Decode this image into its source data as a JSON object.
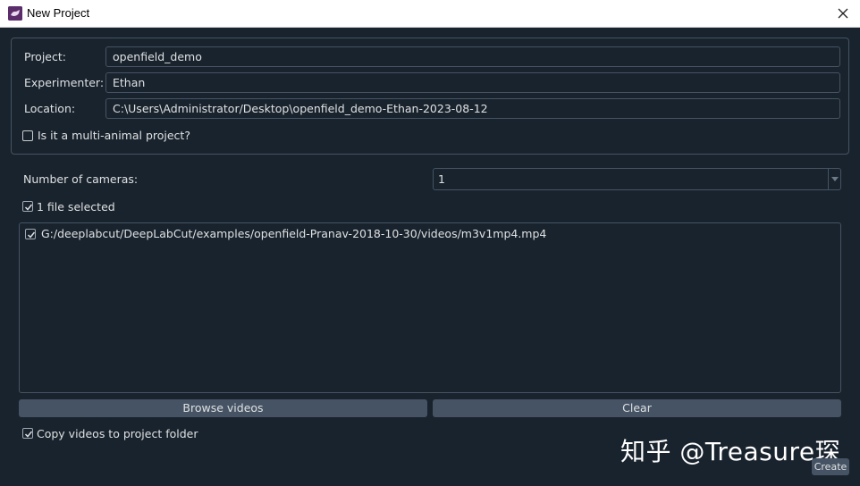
{
  "window": {
    "title": "New Project",
    "icon": "deeplabcut-app-icon"
  },
  "project_group": {
    "project_label": "Project:",
    "project_value": "openfield_demo",
    "experimenter_label": "Experimenter:",
    "experimenter_value": "Ethan",
    "location_label": "Location:",
    "location_value": "C:\\Users\\Administrator/Desktop\\openfield_demo-Ethan-2023-08-12",
    "multi_animal_label": "Is it a multi-animal project?",
    "multi_animal_checked": false
  },
  "cameras": {
    "label": "Number of cameras:",
    "selected": "1"
  },
  "files": {
    "selected_label": "1 file selected",
    "selected_checked": true,
    "items": [
      {
        "path": "G:/deeplabcut/DeepLabCut/examples/openfield-Pranav-2018-10-30/videos/m3v1mp4.mp4",
        "checked": true
      }
    ]
  },
  "buttons": {
    "browse": "Browse videos",
    "clear": "Clear",
    "create": "Create"
  },
  "copy_videos": {
    "label": "Copy videos to project folder",
    "checked": true
  },
  "watermark": "知乎 @Treasure琛",
  "colors": {
    "background": "#19232d",
    "border": "#455364",
    "button": "#455364",
    "text": "#dfe1e2"
  }
}
